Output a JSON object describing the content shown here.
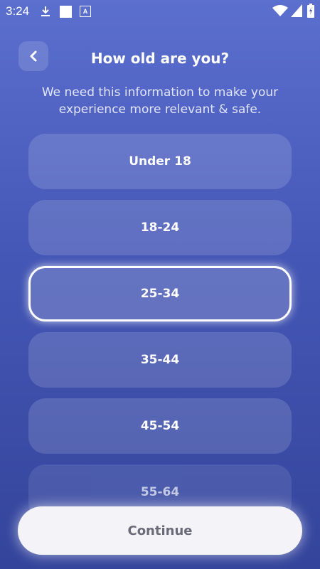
{
  "status_bar": {
    "time": "3:24",
    "icons": [
      "download-icon",
      "square-notification-icon",
      "a-box-icon",
      "wifi-icon",
      "cell-signal-icon",
      "battery-icon"
    ],
    "badge_letter": "A"
  },
  "header": {
    "back_icon": "chevron-left-icon",
    "title": "How old are you?",
    "subtitle": "We need this information to make your experience more relevant & safe."
  },
  "options": [
    {
      "label": "Under 18",
      "selected": false
    },
    {
      "label": "18-24",
      "selected": false
    },
    {
      "label": "25-34",
      "selected": true
    },
    {
      "label": "35-44",
      "selected": false
    },
    {
      "label": "45-54",
      "selected": false
    },
    {
      "label": "55-64",
      "selected": false
    }
  ],
  "footer": {
    "continue_label": "Continue"
  },
  "colors": {
    "background_top": "#5b6fcf",
    "background_bottom": "#34449b",
    "button_bg": "#f4f4f8",
    "button_text": "#6a6a7a"
  }
}
